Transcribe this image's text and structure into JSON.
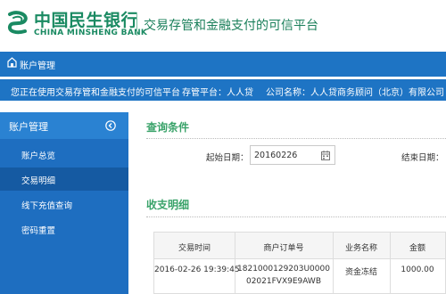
{
  "header": {
    "logo_icon": "minsheng-bank-logo-icon",
    "bank_name_cn": "中国民生银行",
    "bank_name_en": "CHINA MINSHENG BANK",
    "platform_title": "交易存管和金融支付的可信平台",
    "brand_color": "#1a8a62"
  },
  "account_bar": {
    "icon": "home-icon",
    "label": "账户管理",
    "color": "#1e74c4"
  },
  "info_bar": {
    "current_location": "您正在使用交易存管和金融支付的可信平台",
    "platform": "存管平台：人人贷",
    "company": "公司名称：人人贷商务顾问（北京）有限公司"
  },
  "sidebar": {
    "header_label": "账户管理",
    "collapse_icon": "arrow-left-circle-icon",
    "items": [
      {
        "label": "账户总览",
        "active": false
      },
      {
        "label": "交易明细",
        "active": true
      },
      {
        "label": "线下充值查询",
        "active": false
      },
      {
        "label": "密码重置",
        "active": false
      }
    ]
  },
  "query": {
    "title": "查询条件",
    "start_label": "起始日期：",
    "start_value": "20160226",
    "calendar_icon": "calendar-icon",
    "end_label": "结束日期："
  },
  "detail": {
    "title": "收支明细",
    "columns": [
      "交易时间",
      "商户订单号",
      "业务名称",
      "金额"
    ],
    "rows": [
      {
        "time": "2016-02-26 19:39:45",
        "order_line1": "1821000129203U0000",
        "order_line2": "02021FVX9E9AWB",
        "business": "资金冻结",
        "amount": "1000.00"
      }
    ]
  },
  "colors": {
    "accent_blue": "#1e74c4",
    "section_green": "#3aa36a"
  }
}
